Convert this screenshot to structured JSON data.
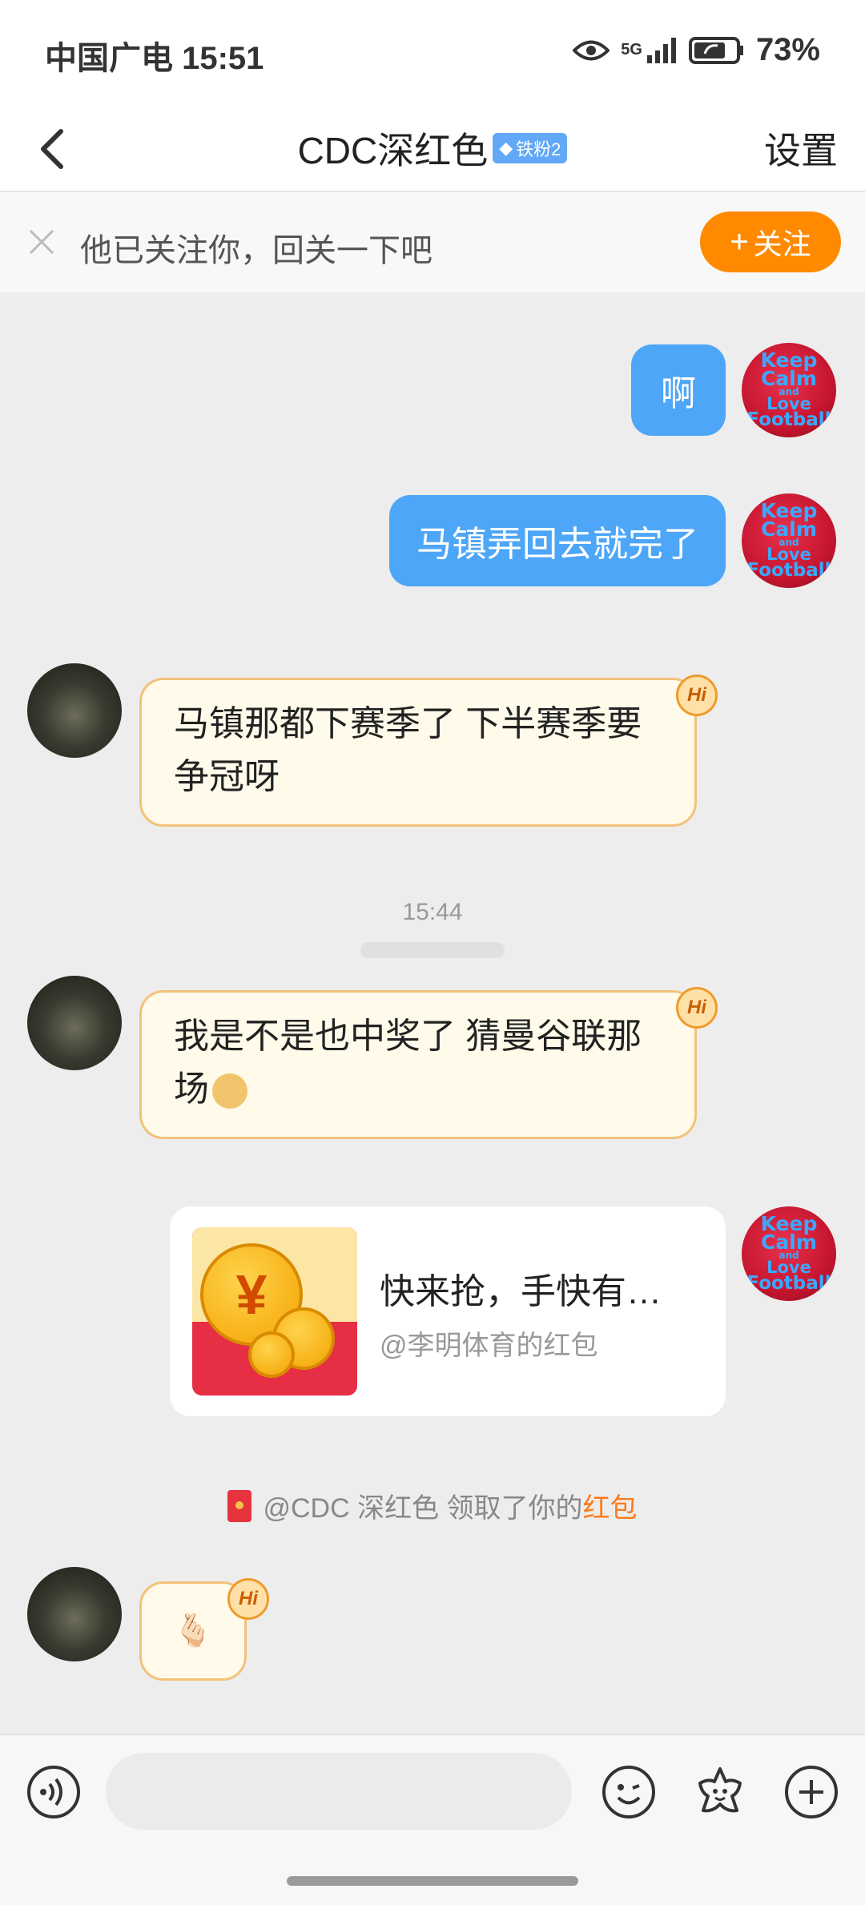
{
  "status_bar": {
    "carrier_time": "中国广电 15:51",
    "network": "5G",
    "battery": "73%"
  },
  "header": {
    "title": "CDC深红色",
    "badge": "铁粉2",
    "settings": "设置"
  },
  "follow_bar": {
    "text": "他已关注你，回关一下吧",
    "button": "关注"
  },
  "avatar_text": [
    "Keep",
    "Calm",
    "and",
    "Love",
    "Football"
  ],
  "messages": [
    {
      "side": "right",
      "text": "啊"
    },
    {
      "side": "right",
      "text": "马镇弄回去就完了"
    },
    {
      "side": "left",
      "line1": "马镇那都下赛季了 下半赛季要",
      "line2": "争冠呀",
      "badge": "Hi"
    },
    {
      "type": "time",
      "text": "15:44"
    },
    {
      "side": "left",
      "line1": "我是不是也中奖了 猜曼谷联那",
      "line2": "场",
      "badge": "Hi"
    },
    {
      "side": "right",
      "type": "red_packet",
      "title": "快来抢，手快有…",
      "subtitle": "@李明体育的红包"
    },
    {
      "type": "notice",
      "prefix": "@CDC 深红色 领取了你的",
      "highlight": "红包"
    },
    {
      "side": "left",
      "emoji": "🫰🏻",
      "badge": "Hi"
    }
  ],
  "colors": {
    "accent_orange": "#ff8a00",
    "bubble_blue": "#4da6f7",
    "bubble_cream": "#fffaea",
    "bubble_border": "#f2c27a"
  }
}
